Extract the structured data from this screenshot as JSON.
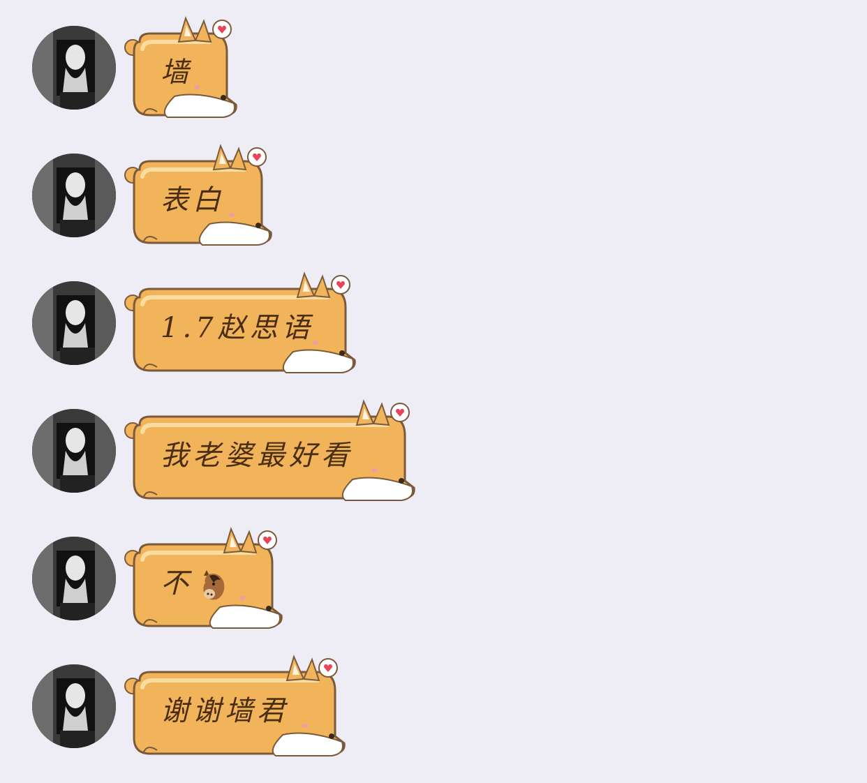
{
  "messages": [
    {
      "text": "墙",
      "emoji": ""
    },
    {
      "text": "表白",
      "emoji": ""
    },
    {
      "text": "1.7赵思语",
      "emoji": ""
    },
    {
      "text": "我老婆最好看",
      "emoji": ""
    },
    {
      "text": "不",
      "emoji": "horse-face-icon"
    },
    {
      "text": "谢谢墙君",
      "emoji": ""
    }
  ],
  "colors": {
    "background": "#eeedf6",
    "bubble_fill": "#f2b45a",
    "bubble_highlight": "#f7cf86",
    "bubble_outline": "#7a5a3a",
    "text": "#4a2e14",
    "heart": "#e8455a"
  },
  "icons": {
    "bubble_decoration": "corgi-bubble-icon",
    "heart": "heart-speech-icon",
    "avatar": "avatar-photo"
  }
}
